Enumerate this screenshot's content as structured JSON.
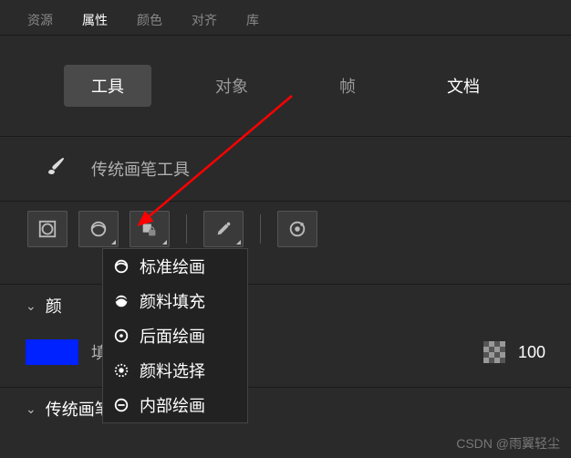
{
  "topTabs": [
    "资源",
    "属性",
    "颜色",
    "对齐",
    "库"
  ],
  "topActiveIndex": 1,
  "secTabs": [
    "工具",
    "对象",
    "帧",
    "文档"
  ],
  "secActiveIndex": 0,
  "toolName": "传统画笔工具",
  "brushModes": {
    "items": [
      "标准绘画",
      "颜料填充",
      "后面绘画",
      "颜料选择",
      "内部绘画"
    ]
  },
  "sections": {
    "color": "颜色",
    "colorTruncated": "颜",
    "fillLabel": "填",
    "fillTruncated": "填",
    "brushOptions": "传统画笔选项"
  },
  "opacity": "100",
  "watermark": "CSDN @雨翼轻尘",
  "colors": {
    "fill": "#0022ff"
  }
}
